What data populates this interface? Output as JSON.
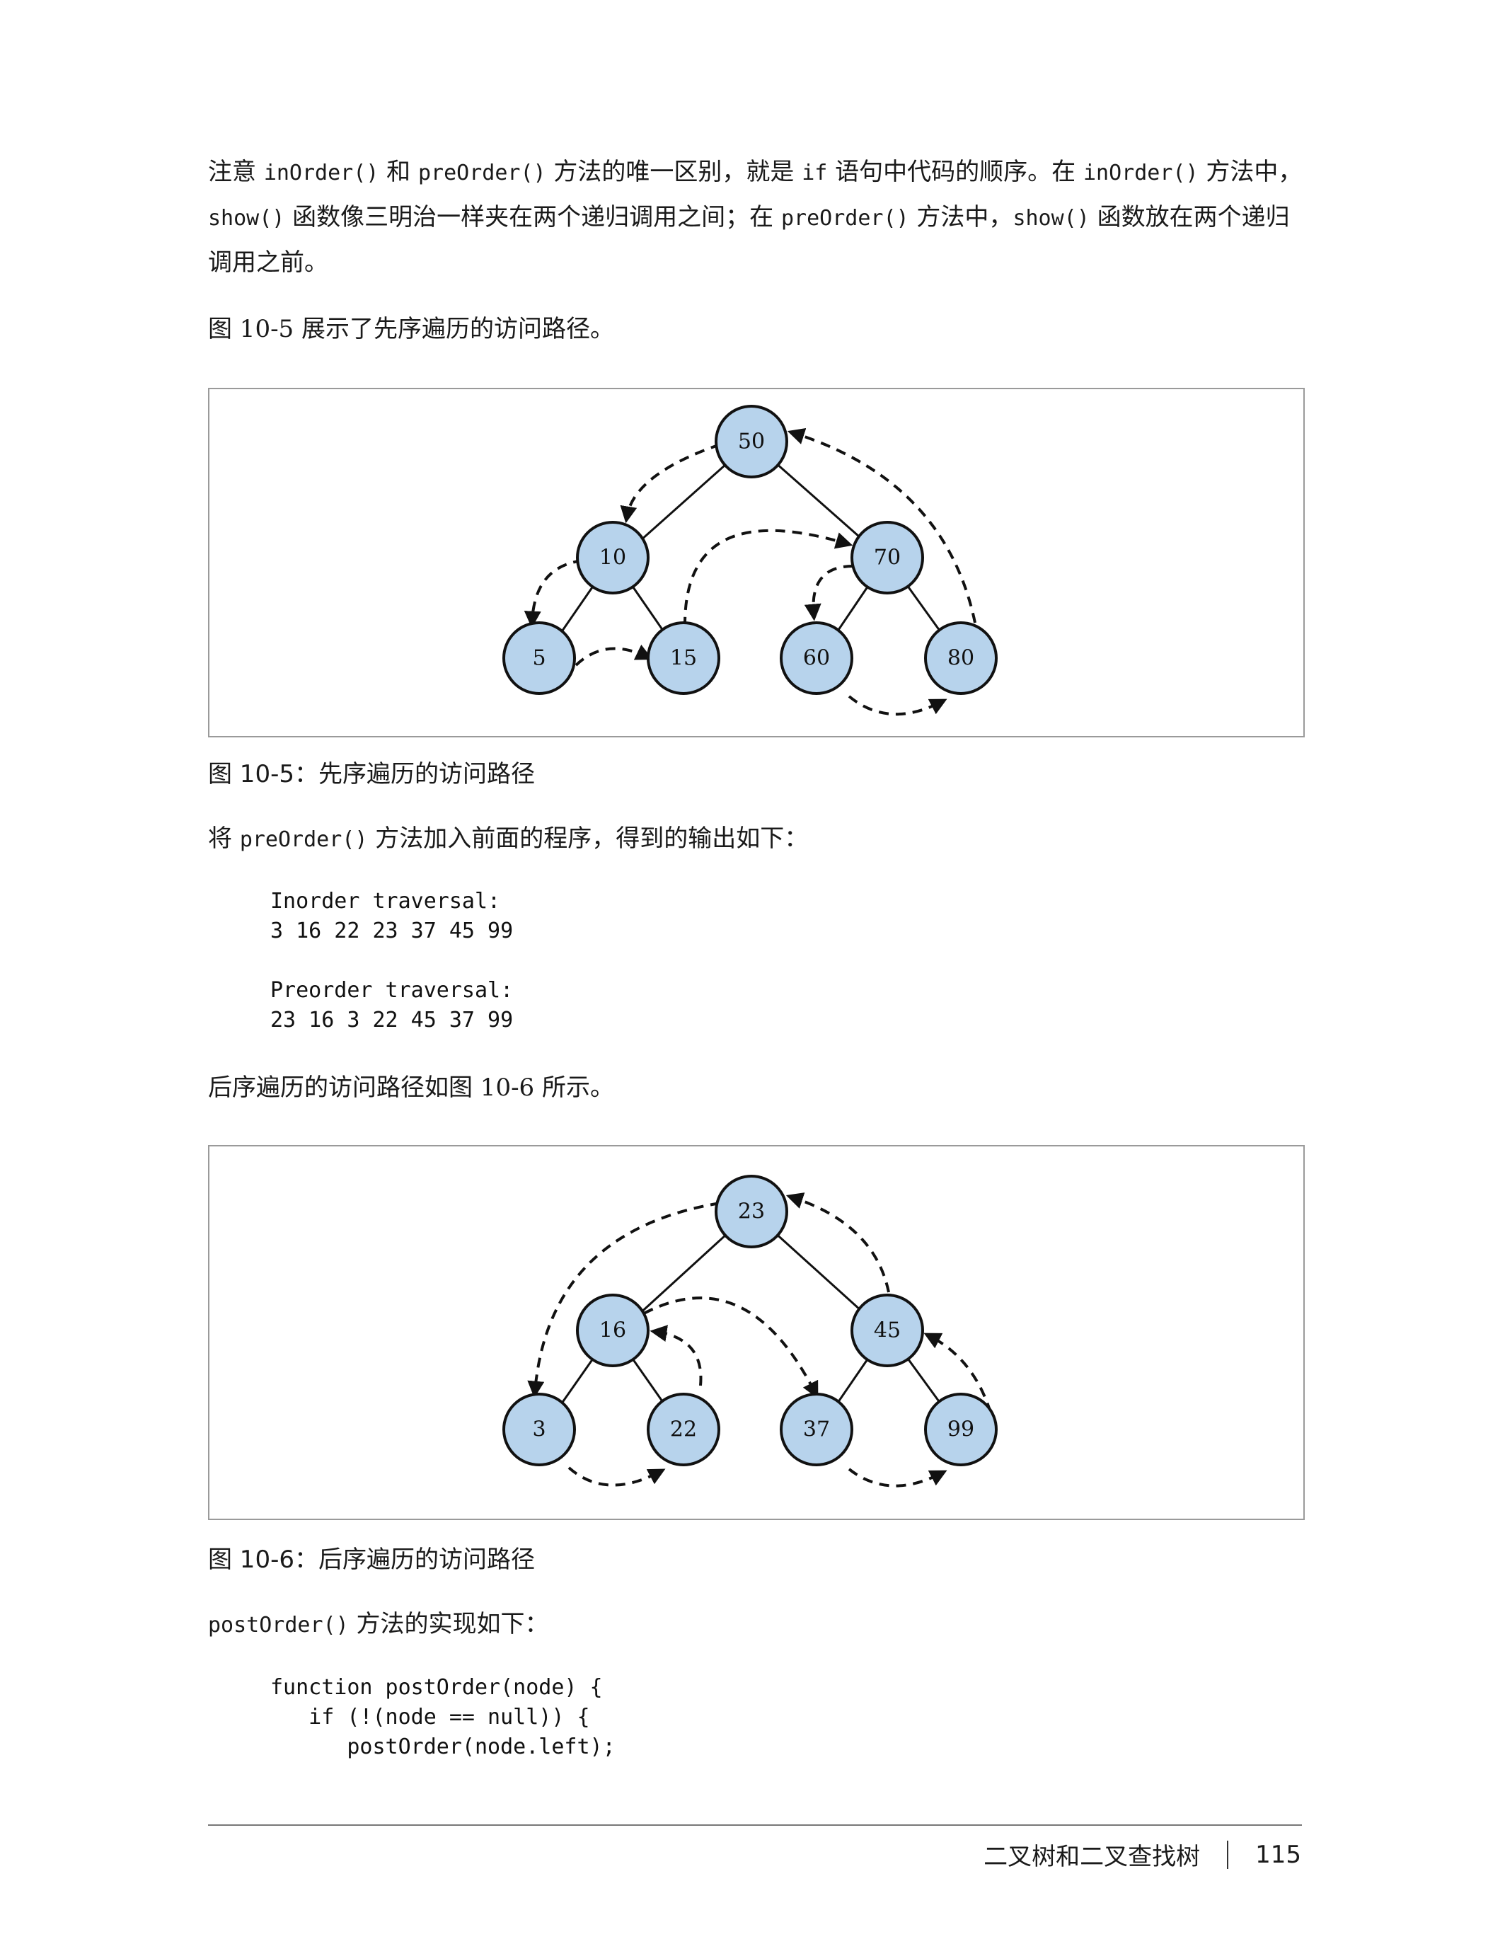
{
  "paragraph1": {
    "t1": "注意 ",
    "c1": "inOrder()",
    "t2": " 和 ",
    "c2": "preOrder()",
    "t3": " 方法的唯一区别，就是 ",
    "c3": "if",
    "t4": " 语句中代码的顺序。在 ",
    "c4": "inOrder()",
    "t5": " 方法中，",
    "c5": "show()",
    "t6": " 函数像三明治一样夹在两个递归调用之间；在 ",
    "c6": "preOrder()",
    "t7": " 方法中，",
    "c7": "show()",
    "t8": " 函数放在两个递归调用之前。"
  },
  "paragraph2": "图 10-5 展示了先序遍历的访问路径。",
  "figure1": {
    "caption": "图 10-5：先序遍历的访问路径",
    "nodes": {
      "root": "50",
      "left": "10",
      "right": "70",
      "ll": "5",
      "lr": "15",
      "rl": "60",
      "rr": "80"
    }
  },
  "paragraph3": {
    "t1": "将 ",
    "c1": "preOrder()",
    "t2": " 方法加入前面的程序，得到的输出如下："
  },
  "output_code": "Inorder traversal:\n3 16 22 23 37 45 99\n\nPreorder traversal:\n23 16 3 22 45 37 99",
  "paragraph4": "后序遍历的访问路径如图 10-6 所示。",
  "figure2": {
    "caption": "图 10-6：后序遍历的访问路径",
    "nodes": {
      "root": "23",
      "left": "16",
      "right": "45",
      "ll": "3",
      "lr": "22",
      "rl": "37",
      "rr": "99"
    }
  },
  "paragraph5": {
    "c1": "postOrder()",
    "t1": " 方法的实现如下："
  },
  "function_code": "function postOrder(node) {\n   if (!(node == null)) {\n      postOrder(node.left);",
  "footer": {
    "chapter": "二叉树和二叉查找树",
    "page": "115"
  }
}
